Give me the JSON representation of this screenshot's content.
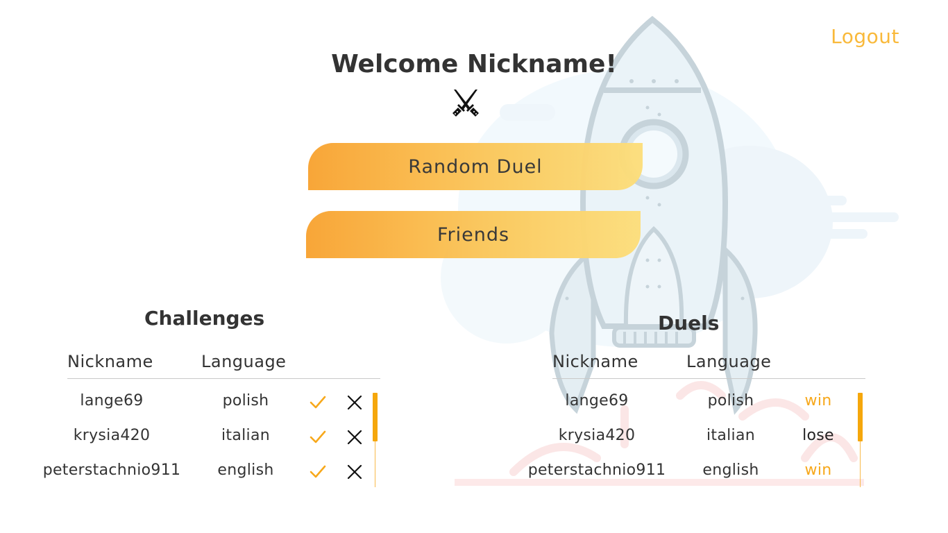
{
  "header": {
    "logout_label": "Logout",
    "welcome_text": "Welcome Nickname!",
    "emblem_icon": "crossed-swords-icon"
  },
  "actions": {
    "random_duel_label": "Random Duel",
    "friends_label": "Friends"
  },
  "colors": {
    "accent": "#f7a81b",
    "button_gradient_start": "#f8a332",
    "button_gradient_end": "#fcde7c",
    "text": "#333333"
  },
  "challenges": {
    "title": "Challenges",
    "columns": [
      "Nickname",
      "Language"
    ],
    "accept_icon": "checkmark-icon",
    "decline_icon": "close-icon",
    "rows": [
      {
        "nickname": "lange69",
        "language": "polish"
      },
      {
        "nickname": "krysia420",
        "language": "italian"
      },
      {
        "nickname": "peterstachnio911",
        "language": "english"
      }
    ]
  },
  "duels": {
    "title": "Duels",
    "columns": [
      "Nickname",
      "Language"
    ],
    "rows": [
      {
        "nickname": "lange69",
        "language": "polish",
        "result": "win"
      },
      {
        "nickname": "krysia420",
        "language": "italian",
        "result": "lose"
      },
      {
        "nickname": "peterstachnio911",
        "language": "english",
        "result": "win"
      }
    ]
  },
  "background": {
    "illustration": "rocket-illustration"
  }
}
